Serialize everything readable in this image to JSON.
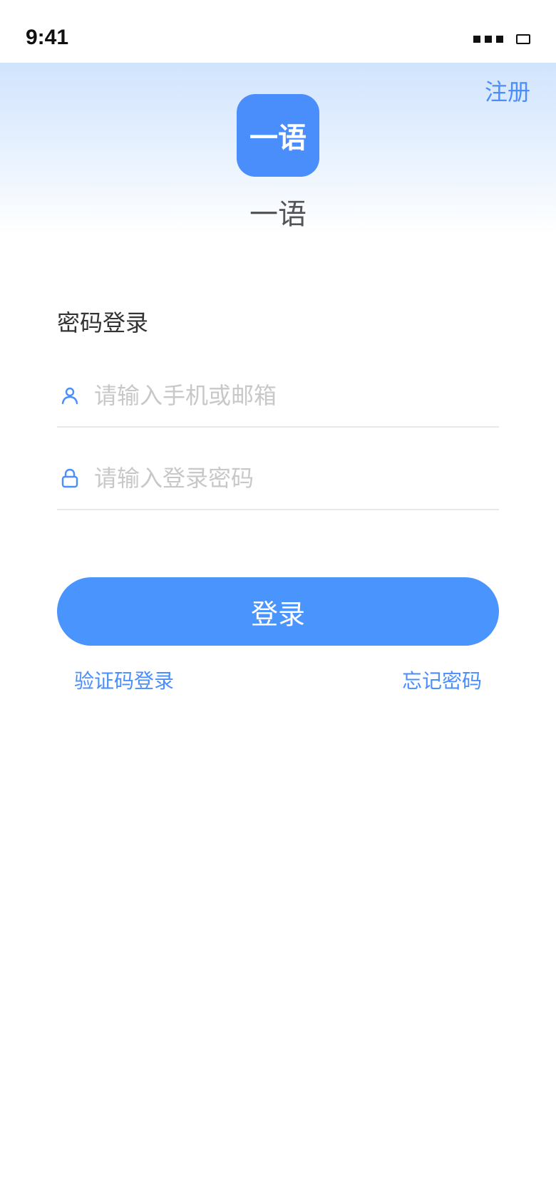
{
  "status_bar": {
    "time": "9:41"
  },
  "header": {
    "register_label": "注册",
    "logo_text": "一语",
    "app_name": "一语"
  },
  "login_form": {
    "title": "密码登录",
    "account_placeholder": "请输入手机或邮箱",
    "account_value": "",
    "password_placeholder": "请输入登录密码",
    "password_value": "",
    "submit_label": "登录"
  },
  "footer_links": {
    "code_login_label": "验证码登录",
    "forgot_password_label": "忘记密码"
  },
  "colors": {
    "accent": "#4a8efc",
    "button": "#4a94fd",
    "header_gradient_top": "#d1e4fd",
    "placeholder": "#c8c8c8",
    "divider": "#e8e8e8"
  },
  "icons": {
    "account": "user-icon",
    "password": "lock-icon"
  }
}
